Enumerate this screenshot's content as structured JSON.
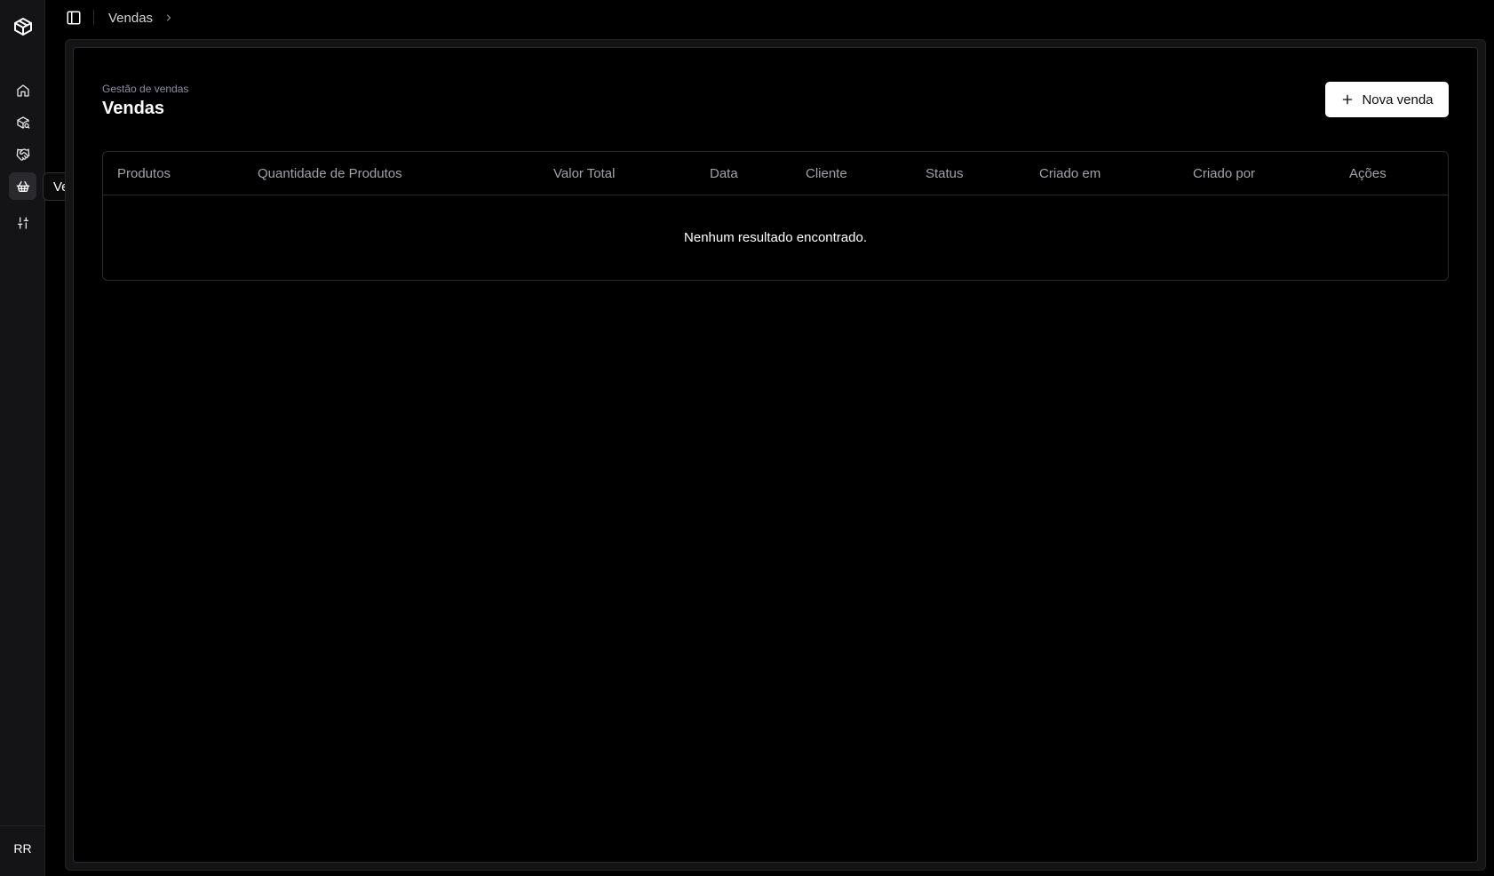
{
  "sidebar": {
    "logo_icon": "box-icon",
    "items": [
      {
        "name": "home",
        "icon": "home-icon",
        "active": false
      },
      {
        "name": "products",
        "icon": "package-search-icon",
        "active": false
      },
      {
        "name": "clients",
        "icon": "handshake-icon",
        "active": false
      },
      {
        "name": "sales",
        "icon": "shopping-basket-icon",
        "active": true
      },
      {
        "name": "settings",
        "icon": "sliders-icon",
        "active": false
      }
    ],
    "avatar_initials": "RR",
    "tooltip": "Vendas"
  },
  "topbar": {
    "toggle_icon": "panel-left-icon",
    "breadcrumb": [
      "Vendas"
    ]
  },
  "page": {
    "subtitle": "Gestão de vendas",
    "title": "Vendas",
    "new_button_label": "Nova venda"
  },
  "table": {
    "columns": [
      "Produtos",
      "Quantidade de Produtos",
      "Valor Total",
      "Data",
      "Cliente",
      "Status",
      "Criado em",
      "Criado por",
      "Ações"
    ],
    "empty_message": "Nenhum resultado encontrado."
  },
  "colors": {
    "background": "#000000",
    "sidebar": "#141416",
    "border": "#2a2a2e",
    "muted_text": "#a1a1aa",
    "subtitle_text": "#8b8fa8",
    "button_bg": "#ffffff"
  }
}
